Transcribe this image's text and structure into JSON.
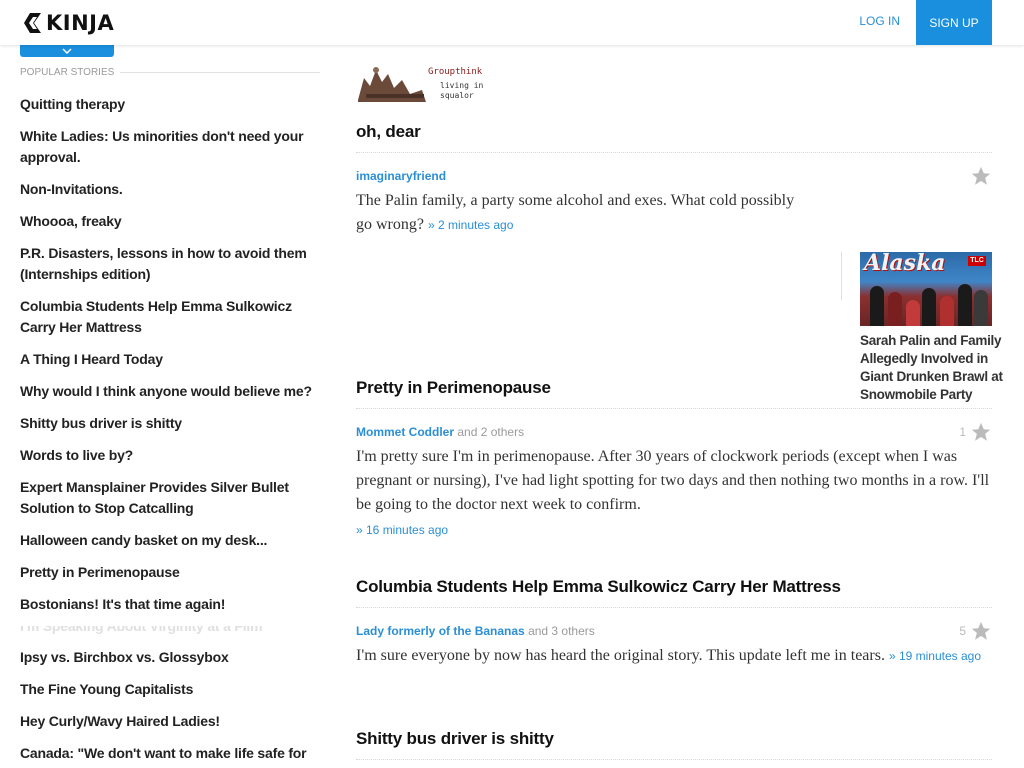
{
  "header": {
    "logo_text": "KINJA",
    "login_label": "LOG IN",
    "signup_label": "SIGN UP"
  },
  "sidebar": {
    "heading": "POPULAR STORIES",
    "stories": [
      "Quitting therapy",
      "White Ladies: Us minorities don't need your approval.",
      "Non-Invitations.",
      "Whoooa, freaky",
      "P.R. Disasters, lessons in how to avoid them (Internships edition)",
      "Columbia Students Help Emma Sulkowicz Carry Her Mattress",
      "A Thing I Heard Today",
      "Why would I think anyone would believe me?",
      "Shitty bus driver is shitty",
      "Words to live by?",
      "Expert Mansplainer Provides Silver Bullet Solution to Stop Catcalling",
      "Halloween candy basket on my desk...",
      "Pretty in Perimenopause",
      "Bostonians! It's that time again!",
      "I'm Speaking About Virginity at a Film Festival!",
      "Ipsy vs. Birchbox vs. Glossybox",
      "The Fine Young Capitalists",
      "Hey Curly/Wavy Haired Ladies!",
      "Canada: \"We don't want to make life safe for"
    ]
  },
  "blog": {
    "logo_name": "Groupthink",
    "logo_tagline_1": "living in",
    "logo_tagline_2": "squalor"
  },
  "posts": [
    {
      "title": "oh, dear",
      "author": "imaginaryfriend",
      "others": "",
      "stars": "",
      "body": "The Palin family, a party some alcohol and exes. What cold possibly go wrong?",
      "time": "» 2 minutes ago",
      "card": {
        "image_title": "Alaska",
        "image_badge": "TLC",
        "title": "Sarah Palin and Family Allegedly Involved in Giant Drunken Brawl at Snowmobile Party"
      }
    },
    {
      "title": "Pretty in Perimenopause",
      "author": "Mommet Coddler",
      "others": "and 2 others",
      "stars": "1",
      "body": "I'm pretty sure I'm in perimenopause. After 30 years of clockwork periods (except when I was pregnant or nursing), I've had light spotting for two days and then nothing two months in a row. I'll be going to the doctor next week to confirm.",
      "time": "» 16 minutes ago"
    },
    {
      "title": "Columbia Students Help Emma Sulkowicz Carry Her Mattress",
      "author": "Lady formerly of the Bananas",
      "others": "and 3 others",
      "stars": "5",
      "body": "I'm sure everyone by now has heard the original story. This update left me in tears.",
      "time": "» 19 minutes ago"
    },
    {
      "title": "Shitty bus driver is shitty"
    }
  ],
  "colors": {
    "accent": "#1a8fde",
    "link": "#2a8fd6",
    "muted": "#9a9a9a"
  }
}
